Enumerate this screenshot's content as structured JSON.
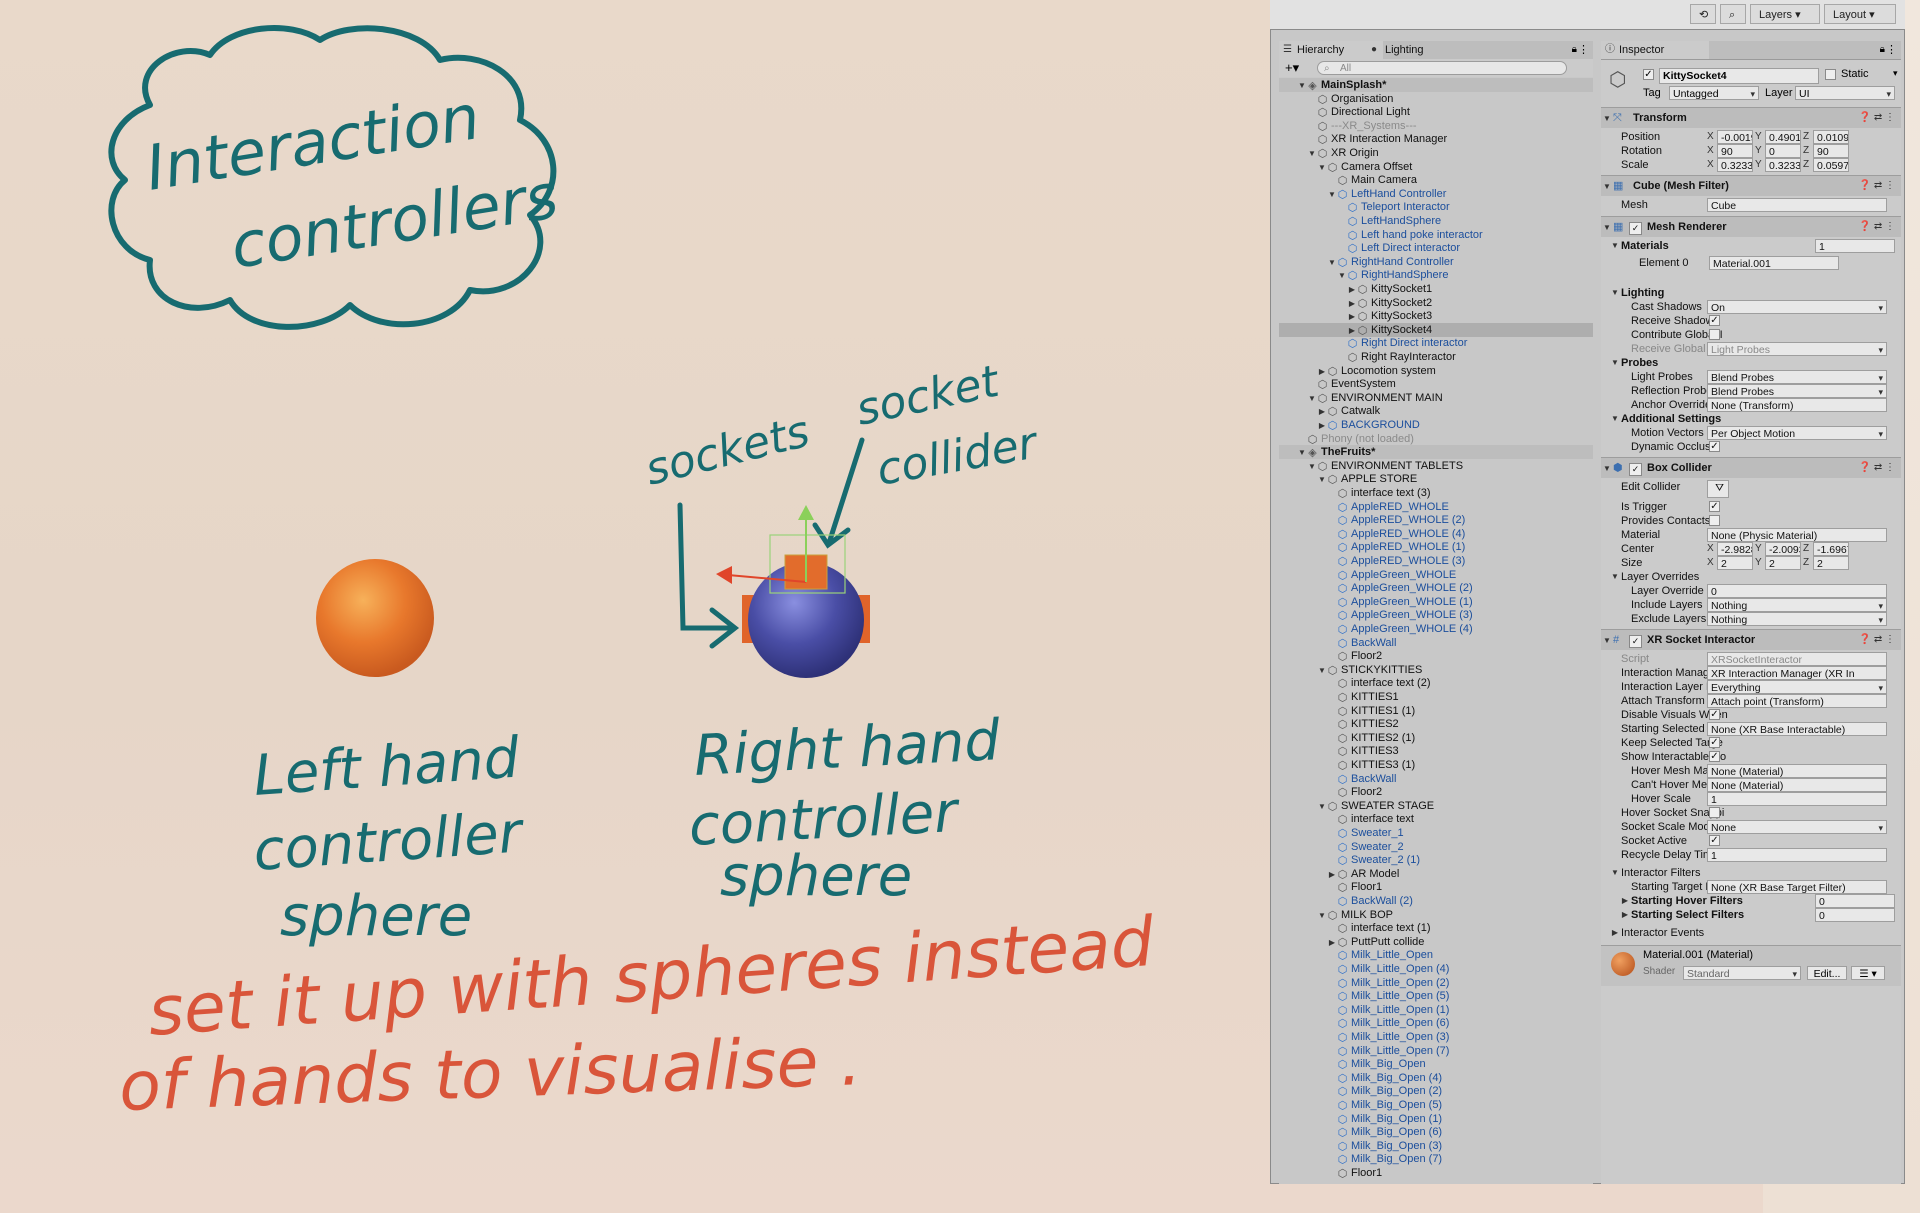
{
  "notes": {
    "title_line1": "Interaction",
    "title_line2": "controllers",
    "label_sockets": "sockets",
    "label_socket_line1": "socket",
    "label_socket_line2": "collider",
    "left_line1": "Left hand",
    "left_line2": "controller",
    "left_line3": "sphere",
    "right_line1": "Right hand",
    "right_line2": "controller",
    "right_line3": "sphere",
    "footer_line1": "set it up with spheres instead",
    "footer_line2": "of hands to visualise ."
  },
  "colors": {
    "teal_ink": "#176b70",
    "red_ink": "#d9553a",
    "sphere_orange": "#e8782c",
    "sphere_blue": "#4a4ea6"
  },
  "toolbar": {
    "layers_label": "Layers",
    "layout_label": "Layout"
  },
  "hierarchy": {
    "tab_label": "Hierarchy",
    "lighting_tab": "Lighting",
    "search_placeholder": "All",
    "rows": [
      {
        "text": "MainSplash*",
        "indent": 0,
        "caret": "▼",
        "type": "scene"
      },
      {
        "text": "Organisation",
        "indent": 1,
        "type": "normal"
      },
      {
        "text": "Directional Light",
        "indent": 1,
        "type": "normal"
      },
      {
        "text": "---XR_Systems---",
        "indent": 1,
        "type": "grey"
      },
      {
        "text": "XR Interaction Manager",
        "indent": 1,
        "type": "normal"
      },
      {
        "text": "XR Origin",
        "indent": 1,
        "caret": "▼",
        "type": "normal"
      },
      {
        "text": "Camera Offset",
        "indent": 2,
        "caret": "▼",
        "type": "normal"
      },
      {
        "text": "Main Camera",
        "indent": 3,
        "type": "normal"
      },
      {
        "text": "LeftHand Controller",
        "indent": 3,
        "caret": "▼",
        "type": "blue"
      },
      {
        "text": "Teleport Interactor",
        "indent": 4,
        "type": "blue"
      },
      {
        "text": "LeftHandSphere",
        "indent": 4,
        "type": "blue"
      },
      {
        "text": "Left hand poke interactor",
        "indent": 4,
        "type": "blue"
      },
      {
        "text": "Left Direct interactor",
        "indent": 4,
        "type": "blue"
      },
      {
        "text": "RightHand Controller",
        "indent": 3,
        "caret": "▼",
        "type": "blue"
      },
      {
        "text": "RightHandSphere",
        "indent": 4,
        "caret": "▼",
        "type": "blue"
      },
      {
        "text": "KittySocket1",
        "indent": 5,
        "caret": "▶",
        "type": "normal"
      },
      {
        "text": "KittySocket2",
        "indent": 5,
        "caret": "▶",
        "type": "normal"
      },
      {
        "text": "KittySocket3",
        "indent": 5,
        "caret": "▶",
        "type": "normal"
      },
      {
        "text": "KittySocket4",
        "indent": 5,
        "caret": "▶",
        "type": "sel"
      },
      {
        "text": "Right Direct interactor",
        "indent": 4,
        "type": "blue"
      },
      {
        "text": "Right RayInteractor",
        "indent": 4,
        "type": "normal"
      },
      {
        "text": "Locomotion system",
        "indent": 2,
        "caret": "▶",
        "type": "normal"
      },
      {
        "text": "EventSystem",
        "indent": 1,
        "type": "normal"
      },
      {
        "text": "ENVIRONMENT MAIN",
        "indent": 1,
        "caret": "▼",
        "type": "normal"
      },
      {
        "text": "Catwalk",
        "indent": 2,
        "caret": "▶",
        "type": "normal"
      },
      {
        "text": "BACKGROUND",
        "indent": 2,
        "caret": "▶",
        "type": "blue"
      },
      {
        "text": "Phony (not loaded)",
        "indent": 0,
        "type": "grey"
      },
      {
        "text": "TheFruits*",
        "indent": 0,
        "caret": "▼",
        "type": "scene"
      },
      {
        "text": "ENVIRONMENT TABLETS",
        "indent": 1,
        "caret": "▼",
        "type": "normal"
      },
      {
        "text": "APPLE STORE",
        "indent": 2,
        "caret": "▼",
        "type": "normal"
      },
      {
        "text": "interface text (3)",
        "indent": 3,
        "type": "normal"
      },
      {
        "text": "AppleRED_WHOLE",
        "indent": 3,
        "type": "blue"
      },
      {
        "text": "AppleRED_WHOLE (2)",
        "indent": 3,
        "type": "blue"
      },
      {
        "text": "AppleRED_WHOLE (4)",
        "indent": 3,
        "type": "blue"
      },
      {
        "text": "AppleRED_WHOLE (1)",
        "indent": 3,
        "type": "blue"
      },
      {
        "text": "AppleRED_WHOLE (3)",
        "indent": 3,
        "type": "blue"
      },
      {
        "text": "AppleGreen_WHOLE",
        "indent": 3,
        "type": "blue"
      },
      {
        "text": "AppleGreen_WHOLE (2)",
        "indent": 3,
        "type": "blue"
      },
      {
        "text": "AppleGreen_WHOLE (1)",
        "indent": 3,
        "type": "blue"
      },
      {
        "text": "AppleGreen_WHOLE (3)",
        "indent": 3,
        "type": "blue"
      },
      {
        "text": "AppleGreen_WHOLE (4)",
        "indent": 3,
        "type": "blue"
      },
      {
        "text": "BackWall",
        "indent": 3,
        "type": "blue"
      },
      {
        "text": "Floor2",
        "indent": 3,
        "type": "normal"
      },
      {
        "text": "STICKYKITTIES",
        "indent": 2,
        "caret": "▼",
        "type": "normal"
      },
      {
        "text": "interface text (2)",
        "indent": 3,
        "type": "normal"
      },
      {
        "text": "KITTIES1",
        "indent": 3,
        "type": "normal"
      },
      {
        "text": "KITTIES1 (1)",
        "indent": 3,
        "type": "normal"
      },
      {
        "text": "KITTIES2",
        "indent": 3,
        "type": "normal"
      },
      {
        "text": "KITTIES2 (1)",
        "indent": 3,
        "type": "normal"
      },
      {
        "text": "KITTIES3",
        "indent": 3,
        "type": "normal"
      },
      {
        "text": "KITTIES3 (1)",
        "indent": 3,
        "type": "normal"
      },
      {
        "text": "BackWall",
        "indent": 3,
        "type": "blue"
      },
      {
        "text": "Floor2",
        "indent": 3,
        "type": "normal"
      },
      {
        "text": "SWEATER STAGE",
        "indent": 2,
        "caret": "▼",
        "type": "normal"
      },
      {
        "text": "interface text",
        "indent": 3,
        "type": "normal"
      },
      {
        "text": "Sweater_1",
        "indent": 3,
        "type": "blue"
      },
      {
        "text": "Sweater_2",
        "indent": 3,
        "type": "blue"
      },
      {
        "text": "Sweater_2 (1)",
        "indent": 3,
        "type": "blue"
      },
      {
        "text": "AR Model",
        "indent": 3,
        "caret": "▶",
        "type": "normal"
      },
      {
        "text": "Floor1",
        "indent": 3,
        "type": "normal"
      },
      {
        "text": "BackWall (2)",
        "indent": 3,
        "type": "blue"
      },
      {
        "text": "MILK BOP",
        "indent": 2,
        "caret": "▼",
        "type": "normal"
      },
      {
        "text": "interface text (1)",
        "indent": 3,
        "type": "normal"
      },
      {
        "text": "PuttPutt collide",
        "indent": 3,
        "caret": "▶",
        "type": "normal"
      },
      {
        "text": "Milk_Little_Open",
        "indent": 3,
        "type": "blue"
      },
      {
        "text": "Milk_Little_Open (4)",
        "indent": 3,
        "type": "blue"
      },
      {
        "text": "Milk_Little_Open (2)",
        "indent": 3,
        "type": "blue"
      },
      {
        "text": "Milk_Little_Open (5)",
        "indent": 3,
        "type": "blue"
      },
      {
        "text": "Milk_Little_Open (1)",
        "indent": 3,
        "type": "blue"
      },
      {
        "text": "Milk_Little_Open (6)",
        "indent": 3,
        "type": "blue"
      },
      {
        "text": "Milk_Little_Open (3)",
        "indent": 3,
        "type": "blue"
      },
      {
        "text": "Milk_Little_Open (7)",
        "indent": 3,
        "type": "blue"
      },
      {
        "text": "Milk_Big_Open",
        "indent": 3,
        "type": "blue"
      },
      {
        "text": "Milk_Big_Open (4)",
        "indent": 3,
        "type": "blue"
      },
      {
        "text": "Milk_Big_Open (2)",
        "indent": 3,
        "type": "blue"
      },
      {
        "text": "Milk_Big_Open (5)",
        "indent": 3,
        "type": "blue"
      },
      {
        "text": "Milk_Big_Open (1)",
        "indent": 3,
        "type": "blue"
      },
      {
        "text": "Milk_Big_Open (6)",
        "indent": 3,
        "type": "blue"
      },
      {
        "text": "Milk_Big_Open (3)",
        "indent": 3,
        "type": "blue"
      },
      {
        "text": "Milk_Big_Open (7)",
        "indent": 3,
        "type": "blue"
      },
      {
        "text": "Floor1",
        "indent": 3,
        "type": "normal"
      }
    ]
  },
  "inspector": {
    "tab_label": "Inspector",
    "object_name": "KittySocket4",
    "static_label": "Static",
    "tag_label": "Tag",
    "tag_value": "Untagged",
    "layer_label": "Layer",
    "layer_value": "UI",
    "transform": {
      "title": "Transform",
      "position_label": "Position",
      "position": [
        "-0.0019",
        "0.49014",
        "0.0109"
      ],
      "rotation_label": "Rotation",
      "rotation": [
        "90",
        "0",
        "90"
      ],
      "scale_label": "Scale",
      "scale": [
        "0.3233",
        "0.3233",
        "0.0597"
      ]
    },
    "mesh_filter": {
      "title": "Cube (Mesh Filter)",
      "mesh_label": "Mesh",
      "mesh_value": "Cube"
    },
    "mesh_renderer": {
      "title": "Mesh Renderer",
      "materials_label": "Materials",
      "materials_count": "1",
      "element0_label": "Element 0",
      "element0_value": "Material.001",
      "lighting_label": "Lighting",
      "cast_shadows_label": "Cast Shadows",
      "cast_shadows_value": "On",
      "receive_shadows_label": "Receive Shadows",
      "contribute_gi_label": "Contribute Global I",
      "receive_gi_label": "Receive Global Illu",
      "receive_gi_value": "Light Probes",
      "probes_label": "Probes",
      "light_probes_label": "Light Probes",
      "light_probes_value": "Blend Probes",
      "reflection_probes_label": "Reflection Probes",
      "reflection_probes_value": "Blend Probes",
      "anchor_override_label": "Anchor Override",
      "anchor_override_value": "None (Transform)",
      "additional_label": "Additional Settings",
      "motion_vectors_label": "Motion Vectors",
      "motion_vectors_value": "Per Object Motion",
      "dynamic_occlusion_label": "Dynamic Occlusio"
    },
    "box_collider": {
      "title": "Box Collider",
      "edit_collider_label": "Edit Collider",
      "is_trigger_label": "Is Trigger",
      "provides_contacts_label": "Provides Contacts",
      "material_label": "Material",
      "material_value": "None (Physic Material)",
      "center_label": "Center",
      "center": [
        "-2.9828",
        "-2.0093",
        "-1.6967"
      ],
      "size_label": "Size",
      "size": [
        "2",
        "2",
        "2"
      ],
      "layer_overrides_label": "Layer Overrides",
      "layer_override_priority_label": "Layer Override Pric",
      "layer_override_priority_value": "0",
      "include_layers_label": "Include Layers",
      "include_layers_value": "Nothing",
      "exclude_layers_label": "Exclude Layers",
      "exclude_layers_value": "Nothing"
    },
    "socket": {
      "title": "XR Socket Interactor",
      "script_label": "Script",
      "script_value": "XRSocketInteractor",
      "interaction_manager_label": "Interaction Manager",
      "interaction_manager_value": "XR Interaction Manager (XR In",
      "interaction_layer_label": "Interaction Layer Mas",
      "interaction_layer_value": "Everything",
      "attach_transform_label": "Attach Transform",
      "attach_transform_value": "Attach point (Transform)",
      "disable_visuals_label": "Disable Visuals When",
      "starting_selected_label": "Starting Selected Inte",
      "starting_selected_value": "None (XR Base Interactable)",
      "keep_selected_label": "Keep Selected Targe",
      "show_interactable_label": "Show Interactable Ho",
      "hover_mesh_material_label": "Hover Mesh Mater",
      "hover_mesh_material_value": "None (Material)",
      "cant_hover_mesh_label": "Can't Hover Mesh",
      "cant_hover_mesh_value": "None (Material)",
      "hover_scale_label": "Hover Scale",
      "hover_scale_value": "1",
      "hover_socket_snapping_label": "Hover Socket Snappi",
      "socket_scale_mode_label": "Socket Scale Mode",
      "socket_scale_mode_value": "None",
      "socket_active_label": "Socket Active",
      "recycle_delay_label": "Recycle Delay Time",
      "recycle_delay_value": "1",
      "interactor_filters_label": "Interactor Filters",
      "starting_target_filter_label": "Starting Target Filt",
      "starting_target_filter_value": "None (XR Base Target Filter)",
      "starting_hover_filters_label": "Starting Hover Filters",
      "starting_hover_filters_value": "0",
      "starting_select_filters_label": "Starting Select Filters",
      "starting_select_filters_value": "0",
      "interactor_events_label": "Interactor Events"
    },
    "material": {
      "title": "Material.001 (Material)",
      "shader_label": "Shader",
      "shader_value": "Standard",
      "edit_label": "Edit..."
    }
  }
}
